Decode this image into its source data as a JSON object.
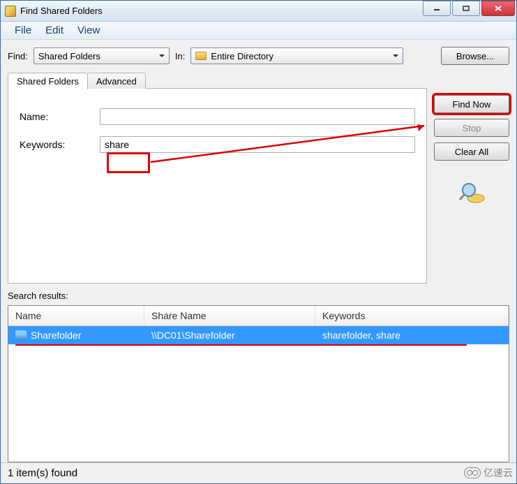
{
  "window": {
    "title": "Find Shared Folders"
  },
  "menubar": {
    "file": "File",
    "edit": "Edit",
    "view": "View"
  },
  "search_bar": {
    "find_label": "Find:",
    "find_value": "Shared Folders",
    "in_label": "In:",
    "in_value": "Entire Directory",
    "browse_label": "Browse..."
  },
  "tabs": {
    "shared_folders": "Shared Folders",
    "advanced": "Advanced"
  },
  "form": {
    "name_label": "Name:",
    "name_value": "",
    "keywords_label": "Keywords:",
    "keywords_value": "share"
  },
  "buttons": {
    "find_now": "Find Now",
    "stop": "Stop",
    "clear_all": "Clear All"
  },
  "results": {
    "label": "Search results:",
    "columns": {
      "name": "Name",
      "share_name": "Share Name",
      "keywords": "Keywords"
    },
    "rows": [
      {
        "name": "Sharefolder",
        "share_name": "\\\\DC01\\Sharefolder",
        "keywords": "sharefolder, share"
      }
    ]
  },
  "statusbar": {
    "text": "1 item(s) found"
  },
  "watermark": {
    "text": "亿速云"
  }
}
